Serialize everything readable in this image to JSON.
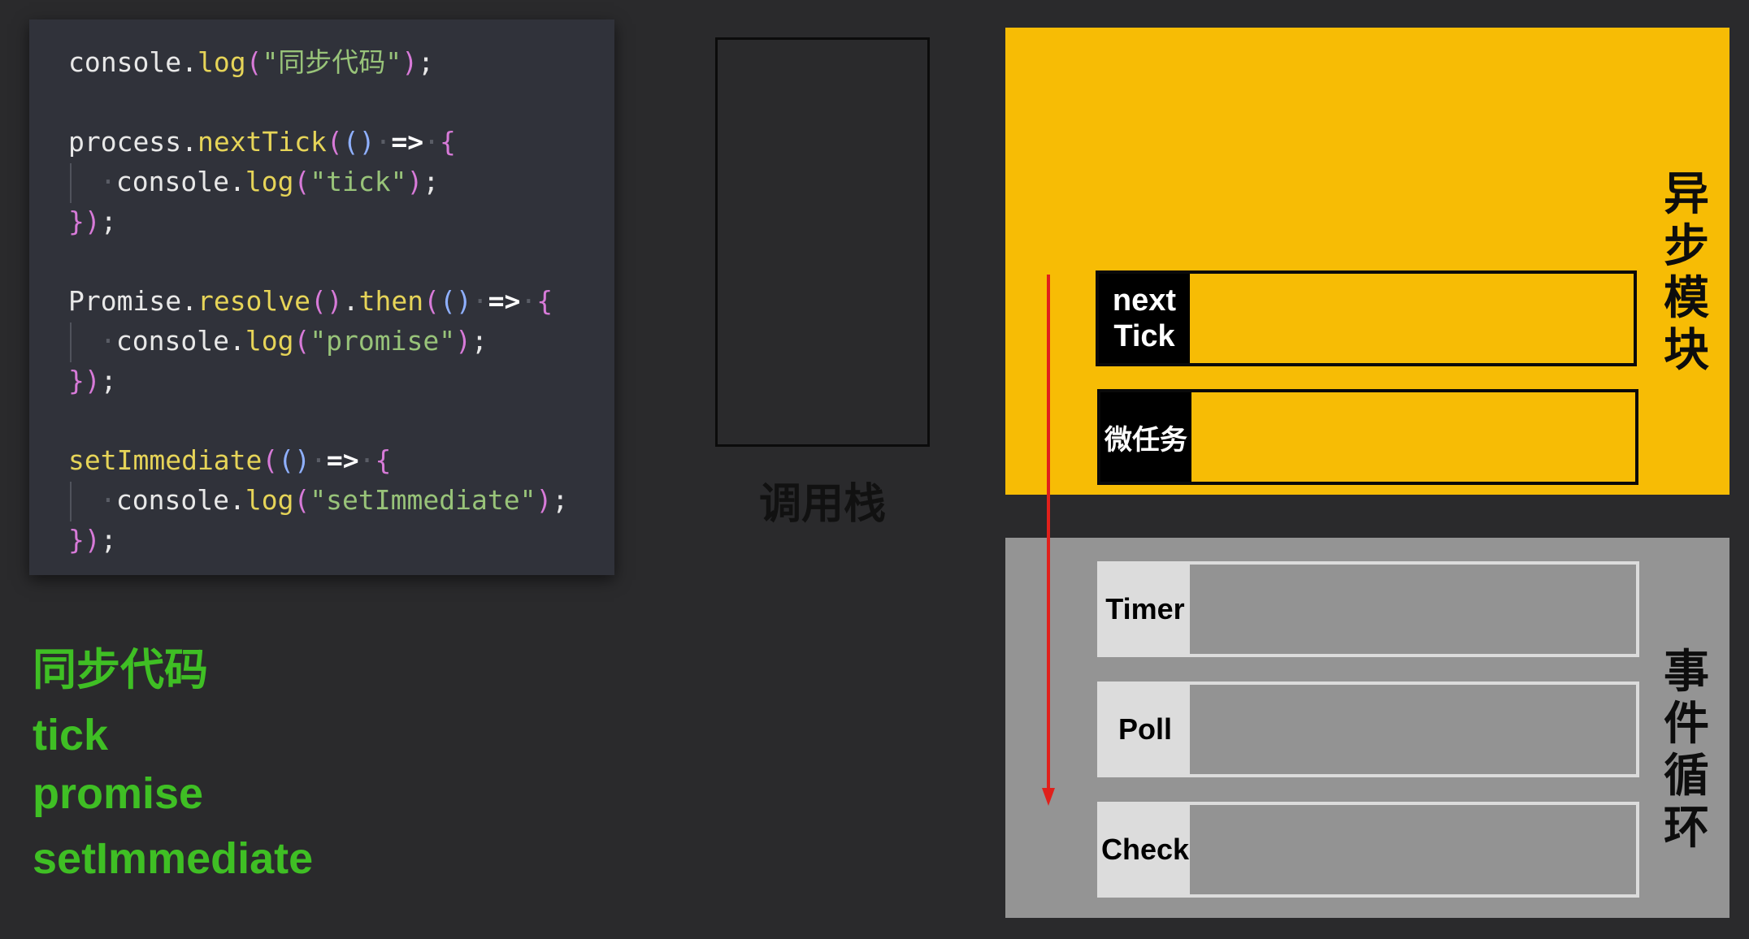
{
  "code": {
    "lines": [
      {
        "indent": false,
        "tokens": [
          {
            "t": "console",
            "c": "cm"
          },
          {
            "t": ".",
            "c": "cm"
          },
          {
            "t": "log",
            "c": "fn"
          },
          {
            "t": "(",
            "c": "pu"
          },
          {
            "t": "\"同步代码\"",
            "c": "str"
          },
          {
            "t": ")",
            "c": "pu"
          },
          {
            "t": ";",
            "c": "cm"
          }
        ]
      },
      {
        "indent": false,
        "tokens": []
      },
      {
        "indent": false,
        "tokens": [
          {
            "t": "process",
            "c": "cm"
          },
          {
            "t": ".",
            "c": "cm"
          },
          {
            "t": "nextTick",
            "c": "fn"
          },
          {
            "t": "(",
            "c": "pu"
          },
          {
            "t": "()",
            "c": "dc"
          },
          {
            "t": "·",
            "c": "dot"
          },
          {
            "t": "=>",
            "c": "op"
          },
          {
            "t": "·",
            "c": "dot"
          },
          {
            "t": "{",
            "c": "pu"
          }
        ]
      },
      {
        "indent": true,
        "tokens": [
          {
            "t": "·",
            "c": "dot"
          },
          {
            "t": "console",
            "c": "cm"
          },
          {
            "t": ".",
            "c": "cm"
          },
          {
            "t": "log",
            "c": "fn"
          },
          {
            "t": "(",
            "c": "pu"
          },
          {
            "t": "\"tick\"",
            "c": "str"
          },
          {
            "t": ")",
            "c": "pu"
          },
          {
            "t": ";",
            "c": "cm"
          }
        ]
      },
      {
        "indent": false,
        "tokens": [
          {
            "t": "}",
            "c": "pu"
          },
          {
            "t": ")",
            "c": "pu"
          },
          {
            "t": ";",
            "c": "cm"
          }
        ]
      },
      {
        "indent": false,
        "tokens": []
      },
      {
        "indent": false,
        "tokens": [
          {
            "t": "Promise",
            "c": "cm"
          },
          {
            "t": ".",
            "c": "cm"
          },
          {
            "t": "resolve",
            "c": "fn"
          },
          {
            "t": "()",
            "c": "pu"
          },
          {
            "t": ".",
            "c": "cm"
          },
          {
            "t": "then",
            "c": "fn"
          },
          {
            "t": "(",
            "c": "pu"
          },
          {
            "t": "()",
            "c": "dc"
          },
          {
            "t": "·",
            "c": "dot"
          },
          {
            "t": "=>",
            "c": "op"
          },
          {
            "t": "·",
            "c": "dot"
          },
          {
            "t": "{",
            "c": "pu"
          }
        ]
      },
      {
        "indent": true,
        "tokens": [
          {
            "t": "·",
            "c": "dot"
          },
          {
            "t": "console",
            "c": "cm"
          },
          {
            "t": ".",
            "c": "cm"
          },
          {
            "t": "log",
            "c": "fn"
          },
          {
            "t": "(",
            "c": "pu"
          },
          {
            "t": "\"promise\"",
            "c": "str"
          },
          {
            "t": ")",
            "c": "pu"
          },
          {
            "t": ";",
            "c": "cm"
          }
        ]
      },
      {
        "indent": false,
        "tokens": [
          {
            "t": "}",
            "c": "pu"
          },
          {
            "t": ")",
            "c": "pu"
          },
          {
            "t": ";",
            "c": "cm"
          }
        ]
      },
      {
        "indent": false,
        "tokens": []
      },
      {
        "indent": false,
        "tokens": [
          {
            "t": "setImmediate",
            "c": "fn"
          },
          {
            "t": "(",
            "c": "pu"
          },
          {
            "t": "()",
            "c": "dc"
          },
          {
            "t": "·",
            "c": "dot"
          },
          {
            "t": "=>",
            "c": "op"
          },
          {
            "t": "·",
            "c": "dot"
          },
          {
            "t": "{",
            "c": "pu"
          }
        ]
      },
      {
        "indent": true,
        "tokens": [
          {
            "t": "·",
            "c": "dot"
          },
          {
            "t": "console",
            "c": "cm"
          },
          {
            "t": ".",
            "c": "cm"
          },
          {
            "t": "log",
            "c": "fn"
          },
          {
            "t": "(",
            "c": "pu"
          },
          {
            "t": "\"setImmediate\"",
            "c": "str"
          },
          {
            "t": ")",
            "c": "pu"
          },
          {
            "t": ";",
            "c": "cm"
          }
        ]
      },
      {
        "indent": false,
        "tokens": [
          {
            "t": "}",
            "c": "pu"
          },
          {
            "t": ")",
            "c": "pu"
          },
          {
            "t": ";",
            "c": "cm"
          }
        ]
      }
    ]
  },
  "output": {
    "items": [
      "同步代码",
      "tick",
      "promise",
      "setImmediate"
    ],
    "color": "#3fbf24"
  },
  "call_stack": {
    "label": "调用栈"
  },
  "async_module": {
    "label": "异步模块",
    "color": "#f7bc05",
    "queues": [
      {
        "label_line1": "next",
        "label_line2": "Tick"
      },
      {
        "label": "微任务"
      }
    ]
  },
  "event_loop": {
    "label": "事件循环",
    "color": "#949494",
    "phases": [
      "Timer",
      "Poll",
      "Check"
    ]
  },
  "arrow_color": "#e0201b"
}
